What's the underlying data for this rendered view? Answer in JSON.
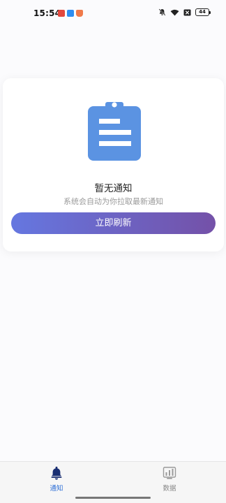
{
  "status_bar": {
    "time": "15:54",
    "battery": "44",
    "app_icons": [
      "red-app-icon",
      "blue-app-icon",
      "orange-app-icon"
    ],
    "indicators": [
      "mute-bell-icon",
      "wifi-icon",
      "close-box-icon"
    ]
  },
  "empty_state": {
    "icon": "clipboard-icon",
    "title": "暂无通知",
    "subtitle": "系统会自动为你拉取最新通知",
    "refresh_label": "立即刷新",
    "accent_start": "#6577e0",
    "accent_end": "#7451a8",
    "icon_color": "#5b93e2"
  },
  "bottom_nav": {
    "items": [
      {
        "label": "通知",
        "icon": "bell-icon",
        "active": true
      },
      {
        "label": "数据",
        "icon": "bar-chart-icon",
        "active": false
      }
    ],
    "active_color": "#2e6fd6"
  }
}
